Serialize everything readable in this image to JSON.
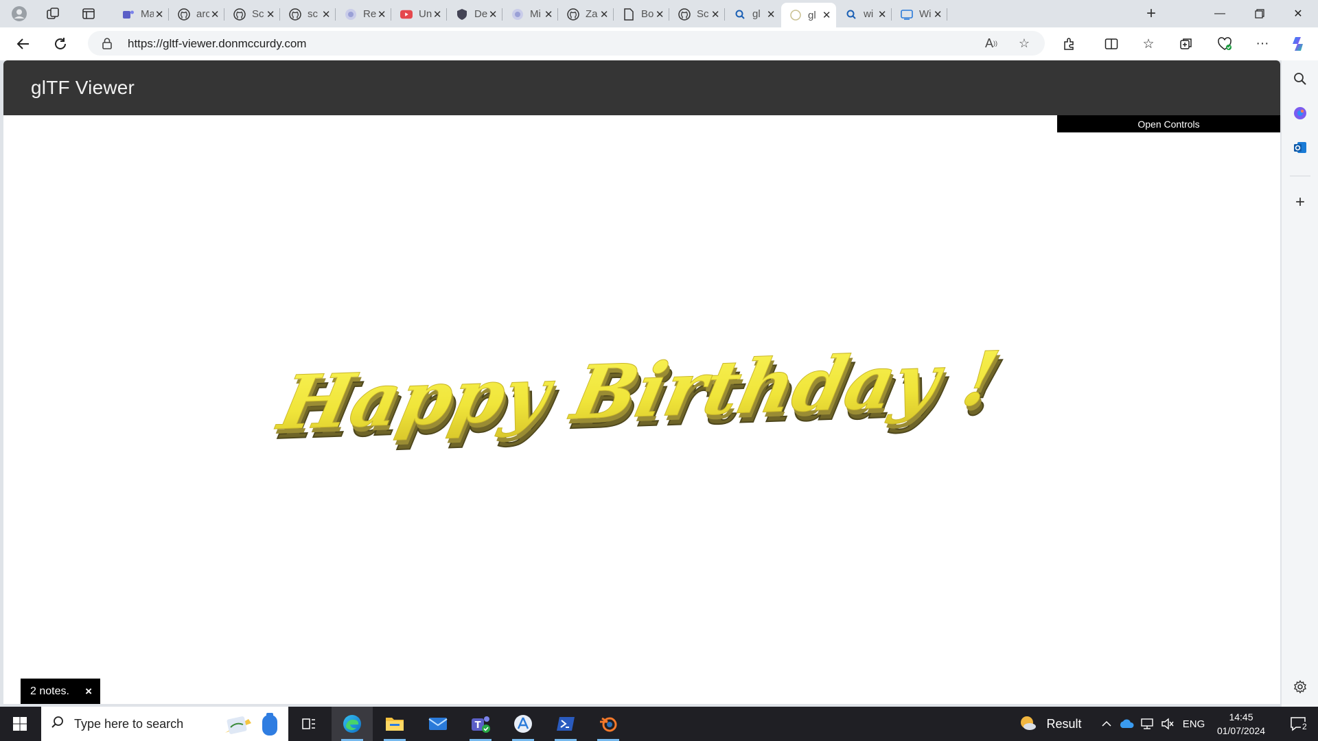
{
  "browser": {
    "tabs": [
      {
        "title": "Ma",
        "icon": "teams-icon"
      },
      {
        "title": "arc",
        "icon": "github-icon"
      },
      {
        "title": "Sc",
        "icon": "github-icon"
      },
      {
        "title": "sc",
        "icon": "github-icon"
      },
      {
        "title": "Re",
        "icon": "globe-icon"
      },
      {
        "title": "Un",
        "icon": "youtube-icon"
      },
      {
        "title": "De",
        "icon": "shield-icon"
      },
      {
        "title": "Mi",
        "icon": "globe-icon"
      },
      {
        "title": "Za",
        "icon": "github-icon"
      },
      {
        "title": "Bo",
        "icon": "document-icon"
      },
      {
        "title": "Sc",
        "icon": "github-icon"
      },
      {
        "title": "gl",
        "icon": "search-icon"
      },
      {
        "title": "gl",
        "icon": "gltf-icon"
      },
      {
        "title": "wi",
        "icon": "search-icon"
      },
      {
        "title": "Wi",
        "icon": "tv-icon"
      }
    ],
    "active_tab_index": 12,
    "url": "https://gltf-viewer.donmccurdy.com"
  },
  "page": {
    "site_title": "glTF Viewer",
    "open_controls_label": "Open Controls",
    "model_text": "Happy Birthday !",
    "notes_label": "2 notes.",
    "notes_close": "×"
  },
  "taskbar": {
    "search_placeholder": "Type here to search",
    "weather_label": "Result",
    "language": "ENG",
    "time": "14:45",
    "date": "01/07/2024",
    "notification_count": "2"
  },
  "colors": {
    "header_bg": "#353535",
    "model_yellow": "#f3ea3c",
    "model_shadow": "#6e6428",
    "taskbar_bg": "#1f1f24"
  }
}
